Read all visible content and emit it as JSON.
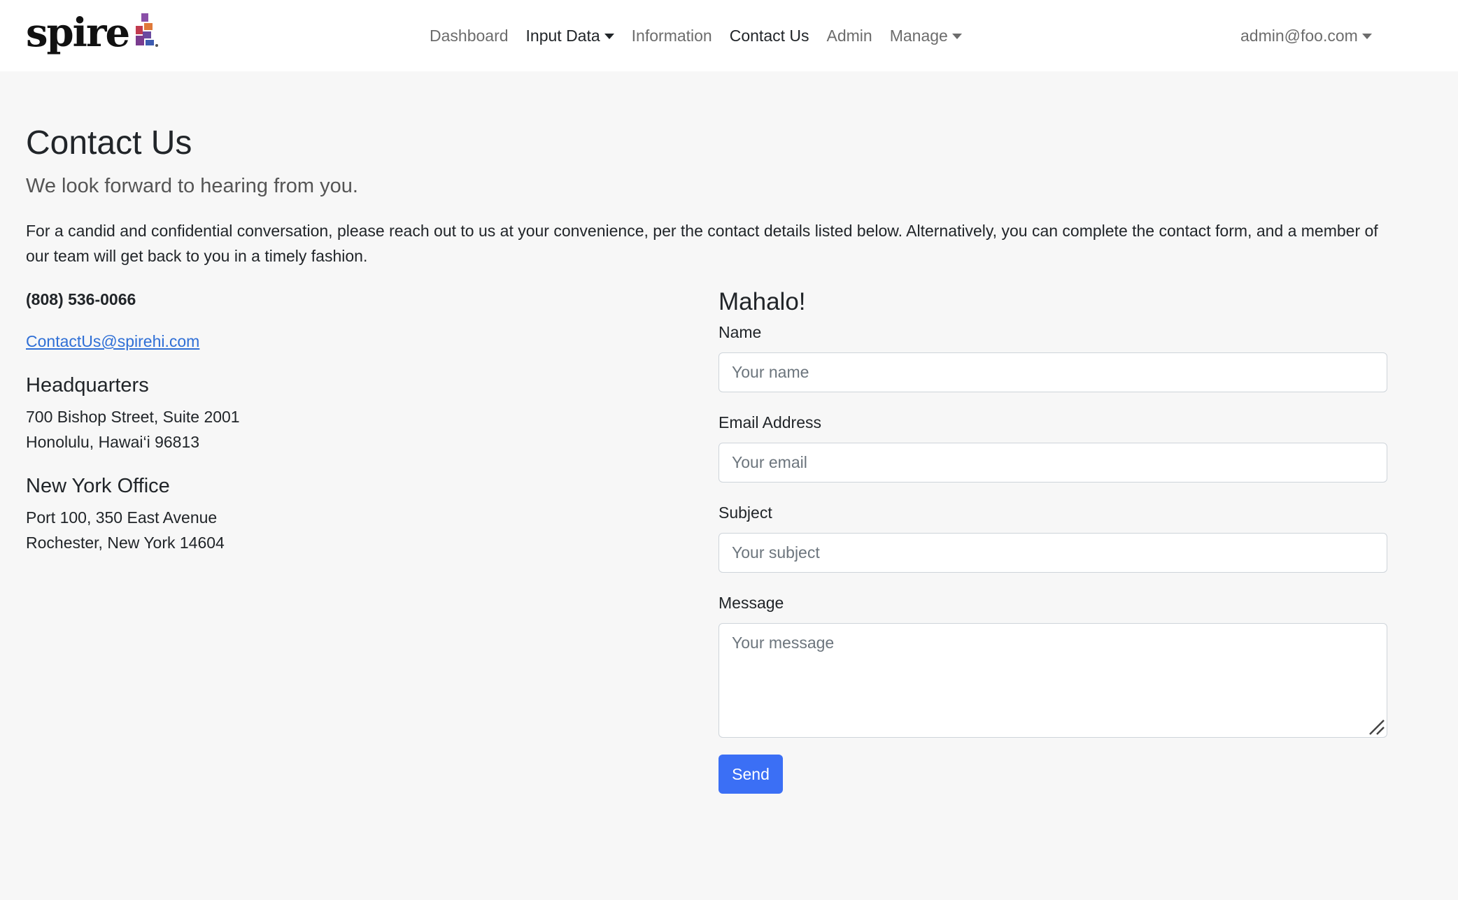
{
  "brand": {
    "name": "spire"
  },
  "nav": {
    "items": [
      {
        "label": "Dashboard"
      },
      {
        "label": "Input Data"
      },
      {
        "label": "Information"
      },
      {
        "label": "Contact Us"
      },
      {
        "label": "Admin"
      },
      {
        "label": "Manage"
      }
    ],
    "user": "admin@foo.com"
  },
  "page": {
    "title": "Contact Us",
    "lead": "We look forward to hearing from you.",
    "intro": "For a candid and confidential conversation, please reach out to us at your convenience, per the contact details listed below. Alternatively, you can complete the contact form, and a member of our team will get back to you in a timely fashion."
  },
  "contact": {
    "phone": "(808) 536-0066",
    "email": "ContactUs@spirehi.com",
    "offices": [
      {
        "name": "Headquarters",
        "line1": "700 Bishop Street, Suite 2001",
        "line2": "Honolulu, Hawai‘i 96813"
      },
      {
        "name": "New York Office",
        "line1": "Port 100, 350 East Avenue",
        "line2": "Rochester, New York 14604"
      }
    ]
  },
  "form": {
    "heading": "Mahalo!",
    "name_label": "Name",
    "name_placeholder": "Your name",
    "email_label": "Email Address",
    "email_placeholder": "Your email",
    "subject_label": "Subject",
    "subject_placeholder": "Your subject",
    "message_label": "Message",
    "message_placeholder": "Your message",
    "send_label": "Send"
  },
  "colors": {
    "accent": "#3b6ff5",
    "link": "#2f6fd6",
    "page_background": "#f7f7f7"
  }
}
